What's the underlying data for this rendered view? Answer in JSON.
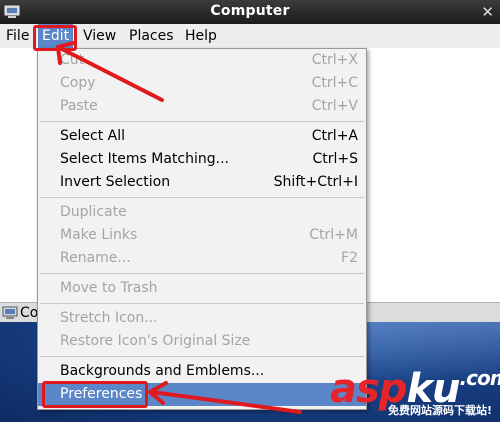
{
  "window": {
    "title": "Computer",
    "close_glyph": "✕"
  },
  "menubar": {
    "items": [
      {
        "label": "File"
      },
      {
        "label": "Edit"
      },
      {
        "label": "View"
      },
      {
        "label": "Places"
      },
      {
        "label": "Help"
      }
    ],
    "active": "Edit"
  },
  "edit_menu": {
    "items": [
      {
        "label": "Cut",
        "accel": "Ctrl+X",
        "enabled": false
      },
      {
        "label": "Copy",
        "accel": "Ctrl+C",
        "enabled": false
      },
      {
        "label": "Paste",
        "accel": "Ctrl+V",
        "enabled": false
      },
      {
        "label": "Select All",
        "accel": "Ctrl+A",
        "enabled": true
      },
      {
        "label": "Select Items Matching...",
        "accel": "Ctrl+S",
        "enabled": true
      },
      {
        "label": "Invert Selection",
        "accel": "Shift+Ctrl+I",
        "enabled": true
      },
      {
        "label": "Duplicate",
        "accel": "",
        "enabled": false
      },
      {
        "label": "Make Links",
        "accel": "Ctrl+M",
        "enabled": false
      },
      {
        "label": "Rename...",
        "accel": "F2",
        "enabled": false
      },
      {
        "label": "Move to Trash",
        "accel": "",
        "enabled": false
      },
      {
        "label": "Stretch Icon...",
        "accel": "",
        "enabled": false
      },
      {
        "label": "Restore Icon's Original Size",
        "accel": "",
        "enabled": false
      },
      {
        "label": "Backgrounds and Emblems...",
        "accel": "",
        "enabled": true
      },
      {
        "label": "Preferences",
        "accel": "",
        "enabled": true,
        "highlighted": true
      }
    ]
  },
  "background_window": {
    "label": "Co"
  },
  "watermark": {
    "brand_red": "asp",
    "brand_white": "ku",
    "suffix": ".com",
    "sub": "免费网站源码下载站!"
  },
  "colors": {
    "highlight": "#5b86c8",
    "annotation": "#e0191f",
    "disabled_text": "#a4a4a4"
  }
}
